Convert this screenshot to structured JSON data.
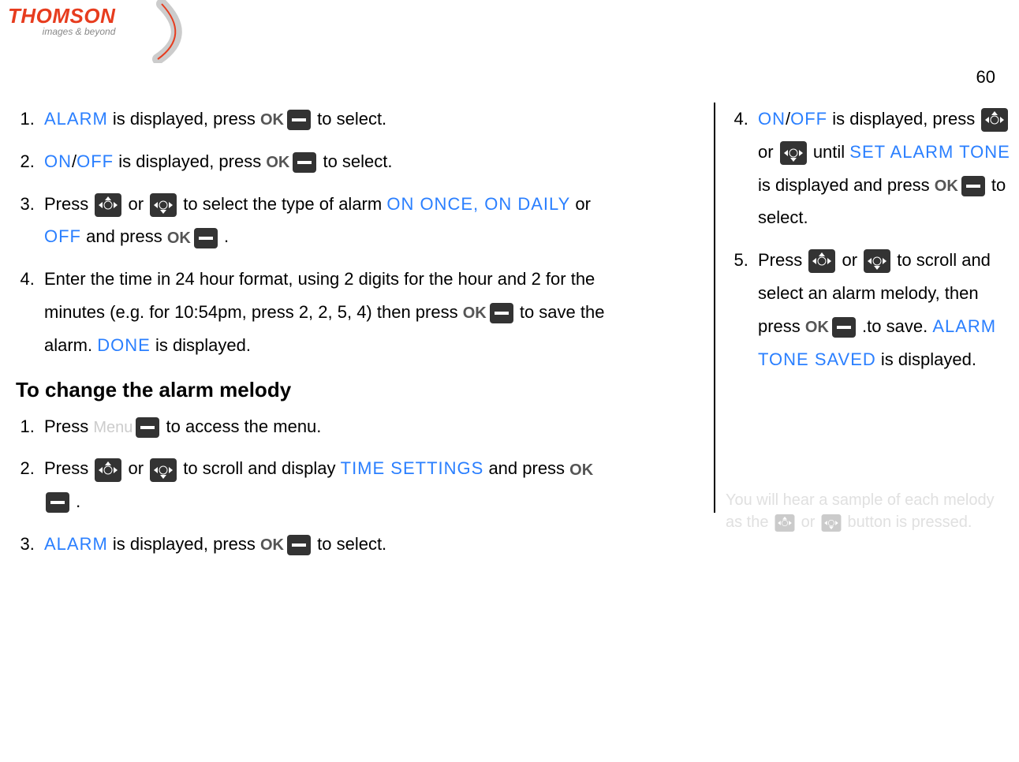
{
  "page_number": "60",
  "logo": {
    "brand": "THOMSON",
    "tagline": "images & beyond"
  },
  "left_column": {
    "list1": {
      "item1": {
        "term": "ALARM",
        "text1": " is displayed, press ",
        "text2": " to select."
      },
      "item2": {
        "term1": "ON",
        "sep": "/",
        "term2": "OFF",
        "text1": " is displayed, press ",
        "text2": " to select."
      },
      "item3": {
        "pre": "Press ",
        "mid": " or ",
        "post": " to select the type of alarm ",
        "opts": "ON ONCE, ON DAILY",
        "or": " or ",
        "off": "OFF",
        "andpress": " and press ",
        "dot": "."
      },
      "item4": {
        "line1": "Enter the time in 24 hour format, using 2 digits for the hour and 2 for the minutes (e.g. for 10:54pm, press 2, 2, 5, 4) then press ",
        "line2": " to save the alarm. ",
        "done": "DONE",
        "line3": " is displayed."
      }
    },
    "heading": "To change the alarm melody",
    "list2": {
      "item1": {
        "pre": "Press ",
        "post": " to access the menu."
      },
      "item2": {
        "pre": "Press ",
        "mid": " or ",
        "post": " to scroll and display ",
        "term": "TIME SETTINGS",
        "andpress": " and press ",
        "dot": "."
      },
      "item3": {
        "term": "ALARM",
        "text1": " is displayed, press ",
        "text2": " to select."
      }
    }
  },
  "right_column": {
    "list": {
      "item4": {
        "term1": "ON",
        "sep": "/",
        "term2": "OFF",
        "text1": " is displayed, press ",
        "mid": " or ",
        "until": " until ",
        "setalarm": "SET ALARM TONE",
        "disp": " is displayed and press ",
        "text2": " to select."
      },
      "item5": {
        "pre": "Press ",
        "mid": " or ",
        "post": " to scroll and select an alarm melody, then press ",
        "dot": ".to save. ",
        "saved": "ALARM TONE SAVED",
        "disp": " is displayed."
      }
    }
  },
  "note": {
    "line1": "You will hear a sample of each melody as the ",
    "mid": " or ",
    "line2": " button is pressed."
  },
  "icons": {
    "ok_label": "OK",
    "menu_label": "Menu"
  }
}
